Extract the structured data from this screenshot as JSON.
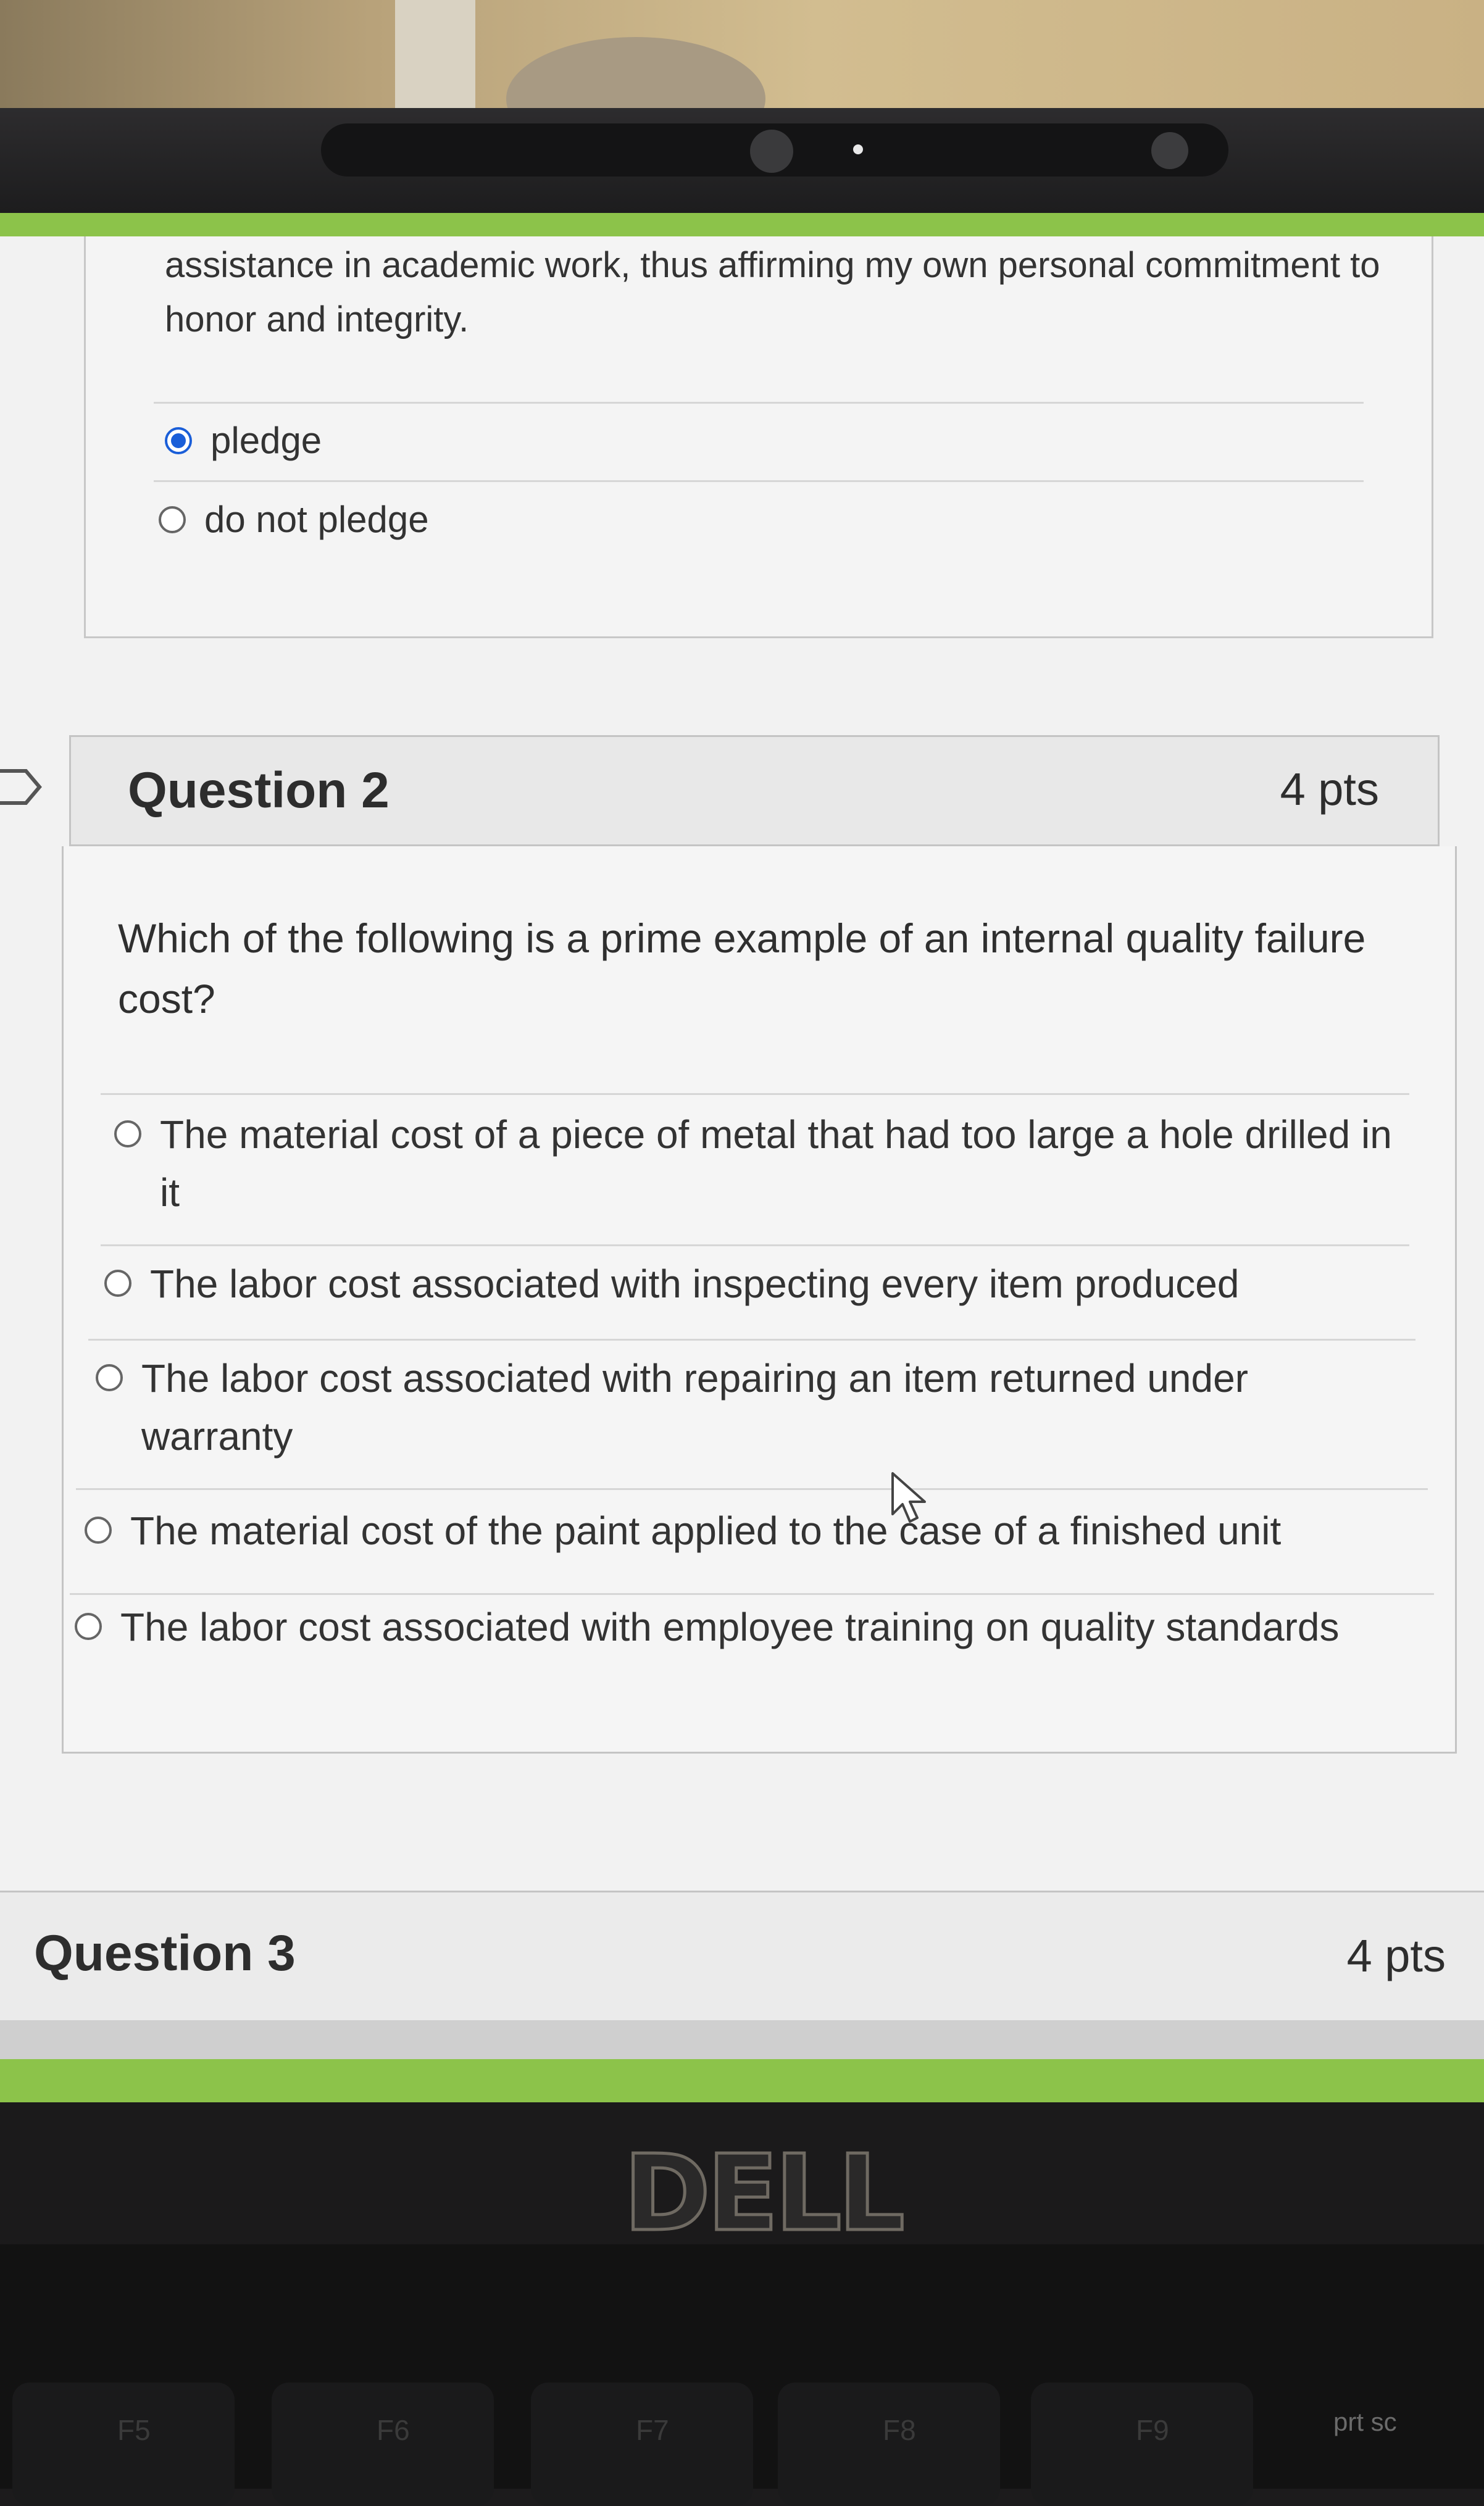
{
  "q1": {
    "statement": "assistance in academic work, thus affirming my own personal commitment to honor and integrity.",
    "options": [
      {
        "label": "pledge",
        "selected": true
      },
      {
        "label": "do not pledge",
        "selected": false
      }
    ]
  },
  "q2": {
    "title": "Question 2",
    "points": "4 pts",
    "text": "Which of the following is a prime example of an internal quality failure cost?",
    "options": [
      {
        "label": "The material cost of a piece of metal that had too large a hole drilled in it",
        "selected": false
      },
      {
        "label": "The labor cost associated with inspecting every item produced",
        "selected": false
      },
      {
        "label": "The labor cost associated with repairing an item returned under warranty",
        "selected": false
      },
      {
        "label": "The material cost of the paint applied to the case of a finished unit",
        "selected": false
      },
      {
        "label": "The labor cost associated with employee training on quality standards",
        "selected": false
      }
    ]
  },
  "q3": {
    "title": "Question 3",
    "points": "4 pts"
  },
  "device": {
    "brand": "DELL",
    "keys": [
      "F5",
      "F6",
      "F7",
      "F8",
      "F9"
    ],
    "prtsc": "prt sc"
  },
  "colors": {
    "accent_green": "#8cc34a",
    "radio_selected": "#1a5ed8"
  },
  "icons": [
    "flag-icon",
    "mouse-cursor-icon",
    "radio-button-icon"
  ]
}
